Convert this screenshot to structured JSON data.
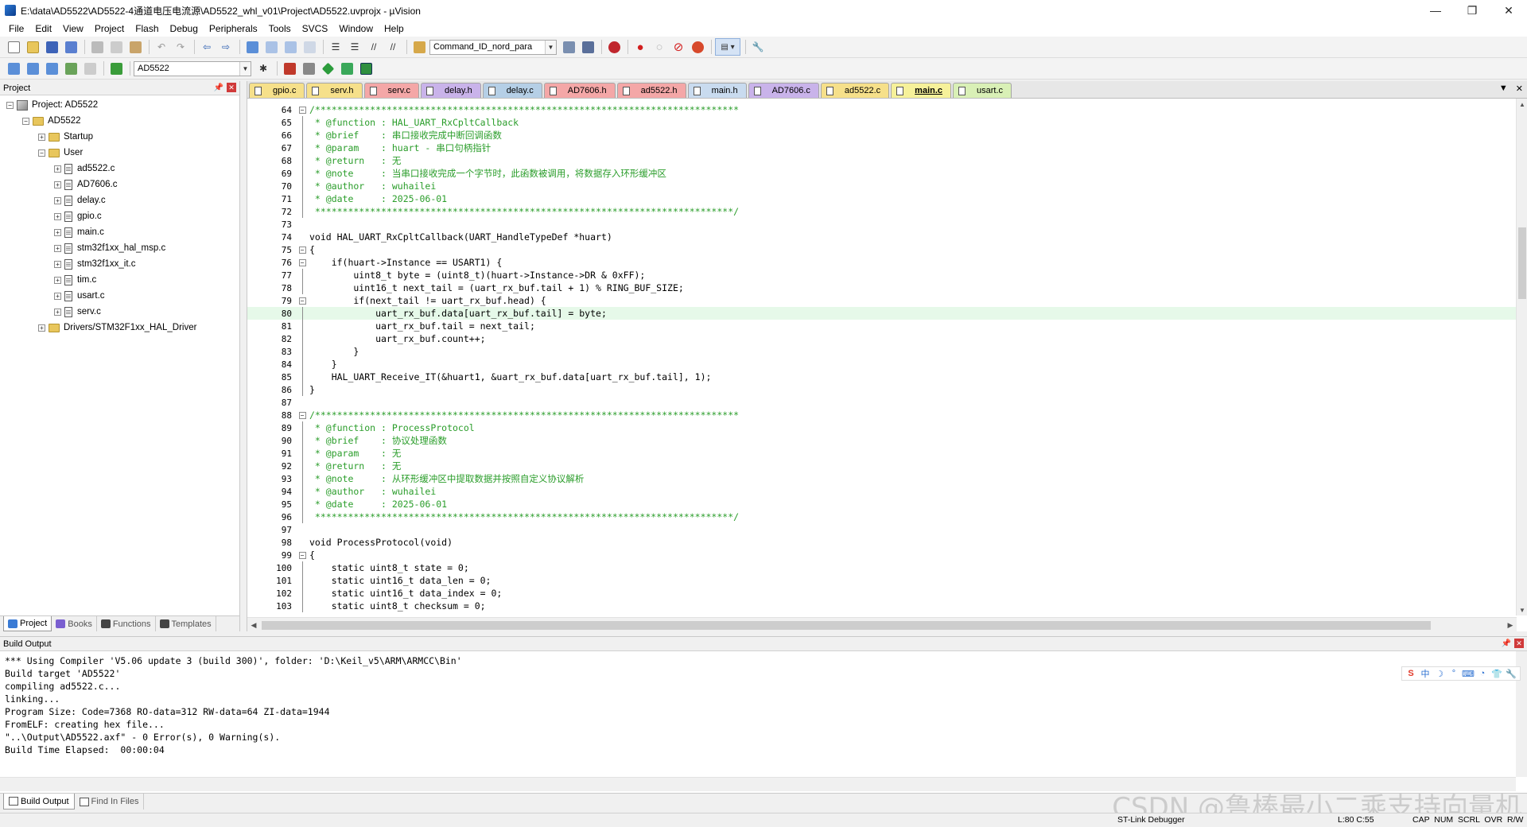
{
  "window": {
    "title": "E:\\data\\AD5522\\AD5522-4通道电压电流源\\AD5522_whl_v01\\Project\\AD5522.uvprojx - µVision",
    "controls": [
      "—",
      "❐",
      "✕"
    ]
  },
  "menu": [
    "File",
    "Edit",
    "View",
    "Project",
    "Flash",
    "Debug",
    "Peripherals",
    "Tools",
    "SVCS",
    "Window",
    "Help"
  ],
  "toolbar": {
    "find_combo": "Command_ID_nord_para",
    "target_combo": "AD5522"
  },
  "project_panel": {
    "header": "Project",
    "tree": [
      {
        "label": "Project: AD5522",
        "level": 0,
        "kind": "project",
        "expander": "−"
      },
      {
        "label": "AD5522",
        "level": 1,
        "kind": "folder",
        "expander": "−"
      },
      {
        "label": "Startup",
        "level": 2,
        "kind": "folder",
        "expander": "+"
      },
      {
        "label": "User",
        "level": 2,
        "kind": "folder",
        "expander": "−"
      },
      {
        "label": "ad5522.c",
        "level": 3,
        "kind": "file",
        "expander": "+"
      },
      {
        "label": "AD7606.c",
        "level": 3,
        "kind": "file",
        "expander": "+"
      },
      {
        "label": "delay.c",
        "level": 3,
        "kind": "file",
        "expander": "+"
      },
      {
        "label": "gpio.c",
        "level": 3,
        "kind": "file",
        "expander": "+"
      },
      {
        "label": "main.c",
        "level": 3,
        "kind": "file",
        "expander": "+"
      },
      {
        "label": "stm32f1xx_hal_msp.c",
        "level": 3,
        "kind": "file",
        "expander": "+"
      },
      {
        "label": "stm32f1xx_it.c",
        "level": 3,
        "kind": "file",
        "expander": "+"
      },
      {
        "label": "tim.c",
        "level": 3,
        "kind": "file",
        "expander": "+"
      },
      {
        "label": "usart.c",
        "level": 3,
        "kind": "file",
        "expander": "+"
      },
      {
        "label": "serv.c",
        "level": 3,
        "kind": "file",
        "expander": "+"
      },
      {
        "label": "Drivers/STM32F1xx_HAL_Driver",
        "level": 2,
        "kind": "folder",
        "expander": "+"
      }
    ],
    "tabs": [
      {
        "label": "Project",
        "active": true,
        "color": "#3a7bd5"
      },
      {
        "label": "Books",
        "active": false,
        "color": "#7a5fd0"
      },
      {
        "label": "Functions",
        "active": false,
        "color": "#444444"
      },
      {
        "label": "Templates",
        "active": false,
        "color": "#444444"
      }
    ]
  },
  "editor": {
    "tabs": [
      {
        "label": "gpio.c",
        "color": "#f6e08a",
        "active": false
      },
      {
        "label": "serv.h",
        "color": "#f6e08a",
        "active": false
      },
      {
        "label": "serv.c",
        "color": "#f4a7a7",
        "active": false
      },
      {
        "label": "delay.h",
        "color": "#c9b3ea",
        "active": false
      },
      {
        "label": "delay.c",
        "color": "#b5cfe6",
        "active": false
      },
      {
        "label": "AD7606.h",
        "color": "#f4a7a7",
        "active": false
      },
      {
        "label": "ad5522.h",
        "color": "#f4a7a7",
        "active": false
      },
      {
        "label": "main.h",
        "color": "#c9dbef",
        "active": false
      },
      {
        "label": "AD7606.c",
        "color": "#c9b3ea",
        "active": false
      },
      {
        "label": "ad5522.c",
        "color": "#f6e08a",
        "active": false
      },
      {
        "label": "main.c",
        "color": "#f6f19a",
        "active": true
      },
      {
        "label": "usart.c",
        "color": "#d9f0b6",
        "active": false
      }
    ],
    "lines": [
      {
        "n": "64",
        "t": "/*****************************************************************************",
        "c": "cmt",
        "f": "box-"
      },
      {
        "n": "65",
        "t": " * @function : HAL_UART_RxCpltCallback",
        "c": "cmt",
        "f": "line"
      },
      {
        "n": "66",
        "t": " * @brief    : 串口接收完成中断回调函数",
        "c": "cmt",
        "f": "line"
      },
      {
        "n": "67",
        "t": " * @param    : huart - 串口句柄指针",
        "c": "cmt",
        "f": "line"
      },
      {
        "n": "68",
        "t": " * @return   : 无",
        "c": "cmt",
        "f": "line"
      },
      {
        "n": "69",
        "t": " * @note     : 当串口接收完成一个字节时，此函数被调用，将数据存入环形缓冲区",
        "c": "cmt",
        "f": "line"
      },
      {
        "n": "70",
        "t": " * @author   : wuhailei",
        "c": "cmt",
        "f": "line"
      },
      {
        "n": "71",
        "t": " * @date     : 2025-06-01",
        "c": "cmt",
        "f": "line"
      },
      {
        "n": "72",
        "t": " ****************************************************************************/",
        "c": "cmt",
        "f": "line"
      },
      {
        "n": "73",
        "t": "",
        "c": "blank",
        "f": ""
      },
      {
        "n": "74",
        "t": "void HAL_UART_RxCpltCallback(UART_HandleTypeDef *huart)",
        "c": "kw",
        "f": ""
      },
      {
        "n": "75",
        "t": "{",
        "c": "kw",
        "f": "box-"
      },
      {
        "n": "76",
        "t": "    if(huart->Instance == USART1) {",
        "c": "kw",
        "f": "box-"
      },
      {
        "n": "77",
        "t": "        uint8_t byte = (uint8_t)(huart->Instance->DR & 0xFF);",
        "c": "kw",
        "f": "line"
      },
      {
        "n": "78",
        "t": "        uint16_t next_tail = (uart_rx_buf.tail + 1) % RING_BUF_SIZE;",
        "c": "kw",
        "f": "line"
      },
      {
        "n": "79",
        "t": "        if(next_tail != uart_rx_buf.head) {",
        "c": "kw",
        "f": "box-"
      },
      {
        "n": "80",
        "t": "            uart_rx_buf.data[uart_rx_buf.tail] = byte;",
        "c": "kw hl",
        "f": "line"
      },
      {
        "n": "81",
        "t": "            uart_rx_buf.tail = next_tail;",
        "c": "kw",
        "f": "line"
      },
      {
        "n": "82",
        "t": "            uart_rx_buf.count++;",
        "c": "kw",
        "f": "line"
      },
      {
        "n": "83",
        "t": "        }",
        "c": "kw",
        "f": "line"
      },
      {
        "n": "84",
        "t": "    }",
        "c": "kw",
        "f": "line"
      },
      {
        "n": "85",
        "t": "    HAL_UART_Receive_IT(&huart1, &uart_rx_buf.data[uart_rx_buf.tail], 1);",
        "c": "kw",
        "f": "line"
      },
      {
        "n": "86",
        "t": "}",
        "c": "kw",
        "f": "line"
      },
      {
        "n": "87",
        "t": "",
        "c": "blank",
        "f": ""
      },
      {
        "n": "88",
        "t": "/*****************************************************************************",
        "c": "cmt",
        "f": "box-"
      },
      {
        "n": "89",
        "t": " * @function : ProcessProtocol",
        "c": "cmt",
        "f": "line"
      },
      {
        "n": "90",
        "t": " * @brief    : 协议处理函数",
        "c": "cmt",
        "f": "line"
      },
      {
        "n": "91",
        "t": " * @param    : 无",
        "c": "cmt",
        "f": "line"
      },
      {
        "n": "92",
        "t": " * @return   : 无",
        "c": "cmt",
        "f": "line"
      },
      {
        "n": "93",
        "t": " * @note     : 从环形缓冲区中提取数据并按照自定义协议解析",
        "c": "cmt",
        "f": "line"
      },
      {
        "n": "94",
        "t": " * @author   : wuhailei",
        "c": "cmt",
        "f": "line"
      },
      {
        "n": "95",
        "t": " * @date     : 2025-06-01",
        "c": "cmt",
        "f": "line"
      },
      {
        "n": "96",
        "t": " ****************************************************************************/",
        "c": "cmt",
        "f": "line"
      },
      {
        "n": "97",
        "t": "",
        "c": "blank",
        "f": ""
      },
      {
        "n": "98",
        "t": "void ProcessProtocol(void)",
        "c": "kw",
        "f": ""
      },
      {
        "n": "99",
        "t": "{",
        "c": "kw",
        "f": "box-"
      },
      {
        "n": "100",
        "t": "    static uint8_t state = 0;",
        "c": "kw",
        "f": "line"
      },
      {
        "n": "101",
        "t": "    static uint16_t data_len = 0;",
        "c": "kw",
        "f": "line"
      },
      {
        "n": "102",
        "t": "    static uint16_t data_index = 0;",
        "c": "kw",
        "f": "line"
      },
      {
        "n": "103",
        "t": "    static uint8_t checksum = 0;",
        "c": "kw",
        "f": "line"
      }
    ]
  },
  "build_output": {
    "header": "Build Output",
    "lines": [
      "*** Using Compiler 'V5.06 update 3 (build 300)', folder: 'D:\\Keil_v5\\ARM\\ARMCC\\Bin'",
      "Build target 'AD5522'",
      "compiling ad5522.c...",
      "linking...",
      "Program Size: Code=7368 RO-data=312 RW-data=64 ZI-data=1944",
      "FromELF: creating hex file...",
      "\"..\\Output\\AD5522.axf\" - 0 Error(s), 0 Warning(s).",
      "Build Time Elapsed:  00:00:04"
    ],
    "tabs": [
      "Build Output",
      "Find In Files"
    ]
  },
  "ime": [
    "S",
    "中",
    "☽",
    "°",
    "⌨",
    "◔",
    "👕",
    "🔧"
  ],
  "watermark": "CSDN @鲁棒最小二乘支持向量机",
  "status": {
    "debugger": "ST-Link Debugger",
    "position": "L:80 C:55",
    "keys": "CAP  NUM  SCRL  OVR  R/W"
  }
}
